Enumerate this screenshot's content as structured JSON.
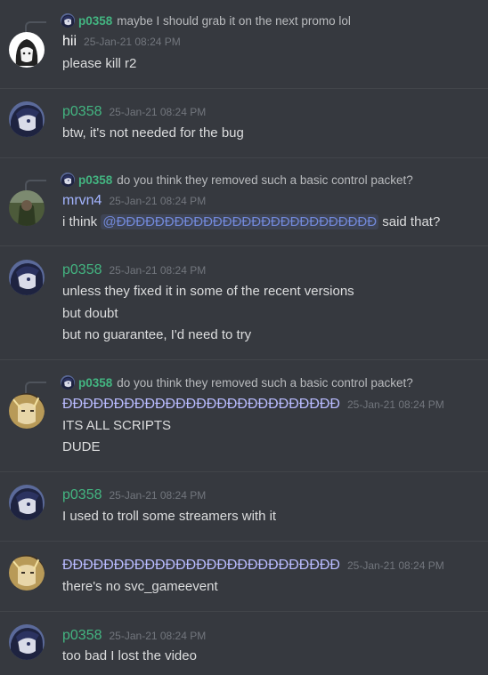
{
  "colors": {
    "background": "#36393f",
    "divider": "#42454a",
    "text": "#dcddde",
    "muted": "#72767d",
    "name_green": "#43b581",
    "mention": "#7289da"
  },
  "messages": [
    {
      "reply": {
        "name": "p0358",
        "text": "maybe I should grab it on the next promo lol"
      },
      "author": "hii",
      "time": "25-Jan-21 08:24 PM",
      "lines": [
        "please kill r2"
      ]
    },
    {
      "author": "p0358",
      "time": "25-Jan-21 08:24 PM",
      "lines": [
        "btw, it's not needed for the bug"
      ]
    },
    {
      "reply": {
        "name": "p0358",
        "text": "do you think they removed such a basic control packet?"
      },
      "author": "mrvn4",
      "time": "25-Jan-21 08:24 PM",
      "line_prefix": "i think ",
      "mention": "@ĐĐĐĐĐĐĐĐĐĐĐĐĐĐĐĐĐĐĐĐĐĐĐĐĐĐĐ",
      "line_suffix": " said that?"
    },
    {
      "author": "p0358",
      "time": "25-Jan-21 08:24 PM",
      "lines": [
        "unless they fixed it in some of the recent versions",
        "but doubt",
        "but no guarantee, I'd need to try"
      ]
    },
    {
      "reply": {
        "name": "p0358",
        "text": "do you think they removed such a basic control packet?"
      },
      "author": "ĐĐĐĐĐĐĐĐĐĐĐĐĐĐĐĐĐĐĐĐĐĐĐĐĐĐĐ",
      "time": "25-Jan-21 08:24 PM",
      "lines": [
        "ITS ALL SCRIPTS",
        "DUDE"
      ]
    },
    {
      "author": "p0358",
      "time": "25-Jan-21 08:24 PM",
      "lines": [
        "I used to troll some streamers with it"
      ]
    },
    {
      "author": "ĐĐĐĐĐĐĐĐĐĐĐĐĐĐĐĐĐĐĐĐĐĐĐĐĐĐĐ",
      "time": "25-Jan-21 08:24 PM",
      "lines": [
        "there's no svc_gameevent"
      ]
    },
    {
      "author": "p0358",
      "time": "25-Jan-21 08:24 PM",
      "lines": [
        "too bad I lost the video"
      ]
    }
  ]
}
